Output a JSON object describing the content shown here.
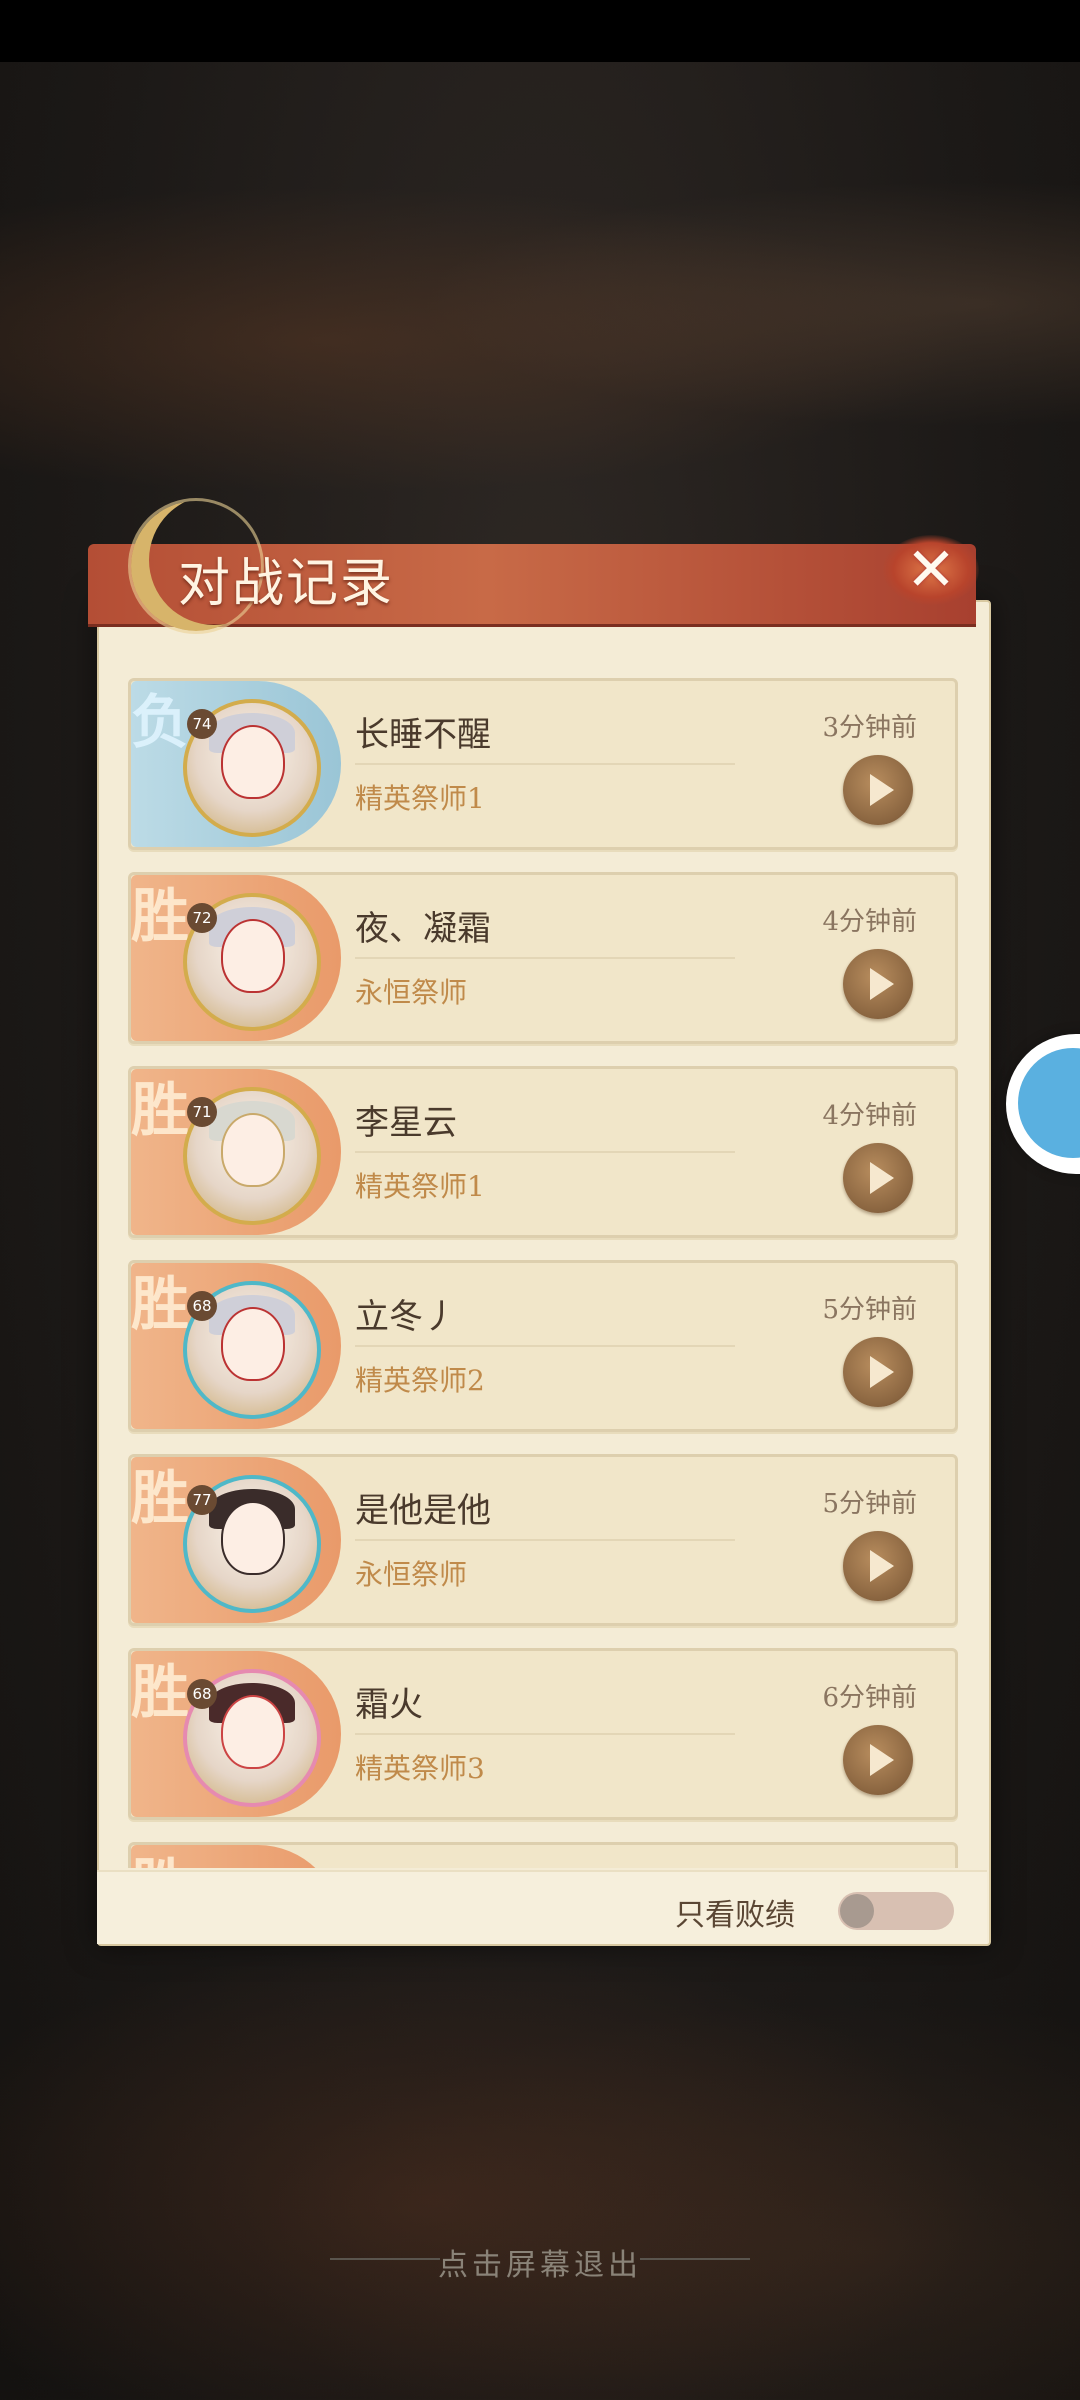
{
  "dialog": {
    "title": "对战记录"
  },
  "records": [
    {
      "result": "负",
      "result_type": "loss",
      "level": "74",
      "name": "长睡不醒",
      "rank": "精英祭师1",
      "time": "3分钟前"
    },
    {
      "result": "胜",
      "result_type": "win",
      "level": "72",
      "name": "夜、凝霜",
      "rank": "永恒祭师",
      "time": "4分钟前"
    },
    {
      "result": "胜",
      "result_type": "win",
      "level": "71",
      "name": "李星云",
      "rank": "精英祭师1",
      "time": "4分钟前"
    },
    {
      "result": "胜",
      "result_type": "win",
      "level": "68",
      "name": "立冬丿",
      "rank": "精英祭师2",
      "time": "5分钟前"
    },
    {
      "result": "胜",
      "result_type": "win",
      "level": "77",
      "name": "是他是他",
      "rank": "永恒祭师",
      "time": "5分钟前"
    },
    {
      "result": "胜",
      "result_type": "win",
      "level": "68",
      "name": "霜火",
      "rank": "精英祭师3",
      "time": "6分钟前"
    },
    {
      "result": "胜",
      "result_type": "win"
    }
  ],
  "filter": {
    "label": "只看败绩",
    "enabled": false
  },
  "exit_hint": "点击屏幕退出",
  "icons": {
    "close": "close-icon",
    "play": "play-icon",
    "moon": "moon-emblem",
    "float": "floating-assistant-icon"
  },
  "colors": {
    "win": "#e99a6a",
    "loss": "#9ac5d6",
    "header": "#b44e35",
    "panel": "#f4ecd6"
  }
}
